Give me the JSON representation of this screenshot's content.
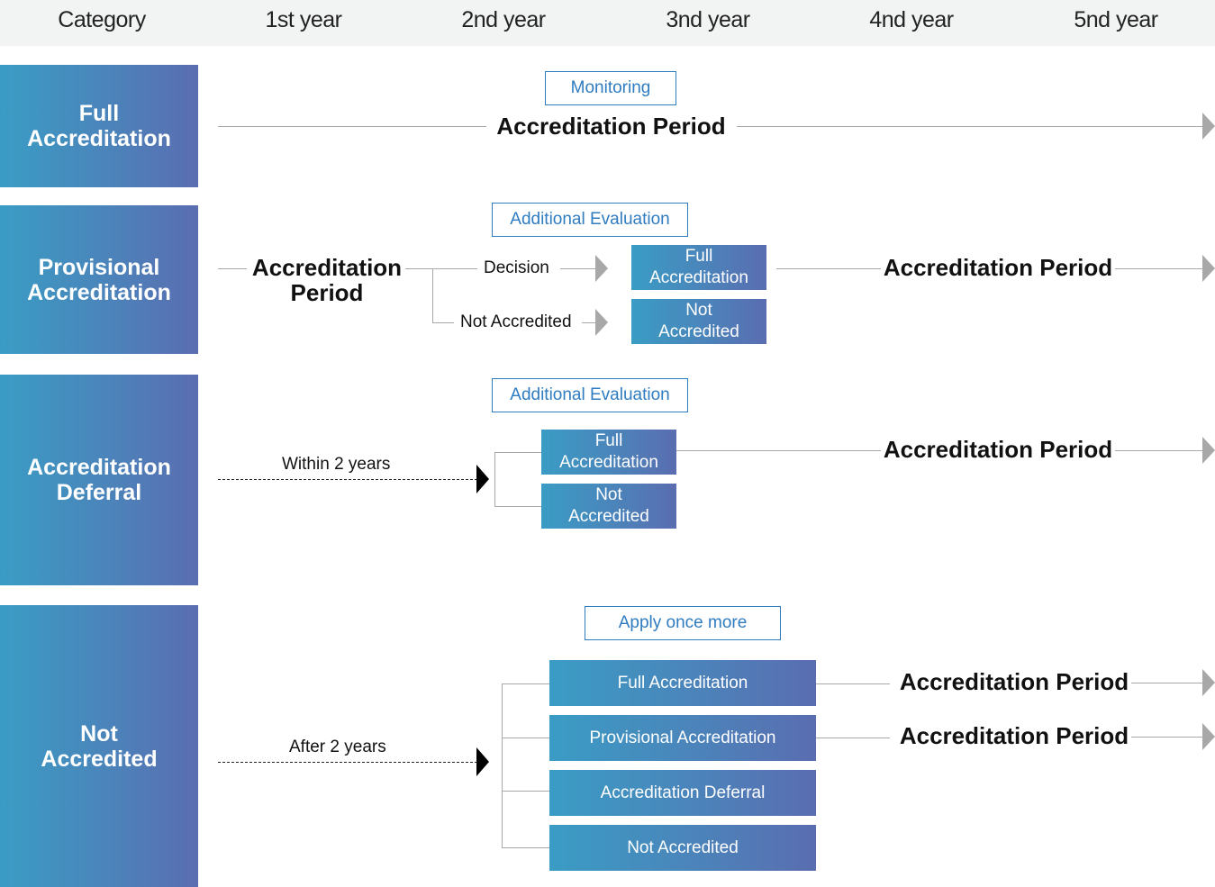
{
  "header": {
    "columns": [
      "Category",
      "1st year",
      "2nd year",
      "3nd year",
      "4nd year",
      "5nd year"
    ]
  },
  "colors": {
    "gradient_start": "#3a9cc4",
    "gradient_end": "#5a6db0",
    "outline_blue": "#2f7cc0",
    "line_gray": "#a8a8a8",
    "header_bg": "#f2f3f3"
  },
  "rows": [
    {
      "category": "Full\nAccreditation",
      "tag": "Monitoring",
      "period": "Accreditation Period"
    },
    {
      "category": "Provisional\nAccreditation",
      "tag": "Additional Evaluation",
      "period_start": "Accreditation\nPeriod",
      "branches": [
        "Decision",
        "Not Accredited"
      ],
      "results": [
        "Full\nAccreditation",
        "Not\nAccredited"
      ],
      "period": "Accreditation Period"
    },
    {
      "category": "Accreditation\nDeferral",
      "tag": "Additional Evaluation",
      "trigger": "Within 2 years",
      "results": [
        "Full\nAccreditation",
        "Not\nAccredited"
      ],
      "period": "Accreditation Period"
    },
    {
      "category": "Not\nAccredited",
      "tag": "Apply once more",
      "trigger": "After 2 years",
      "results": [
        "Full Accreditation",
        "Provisional Accreditation",
        "Accreditation Deferral",
        "Not Accredited"
      ],
      "periods": [
        "Accreditation Period",
        "Accreditation Period"
      ]
    }
  ]
}
